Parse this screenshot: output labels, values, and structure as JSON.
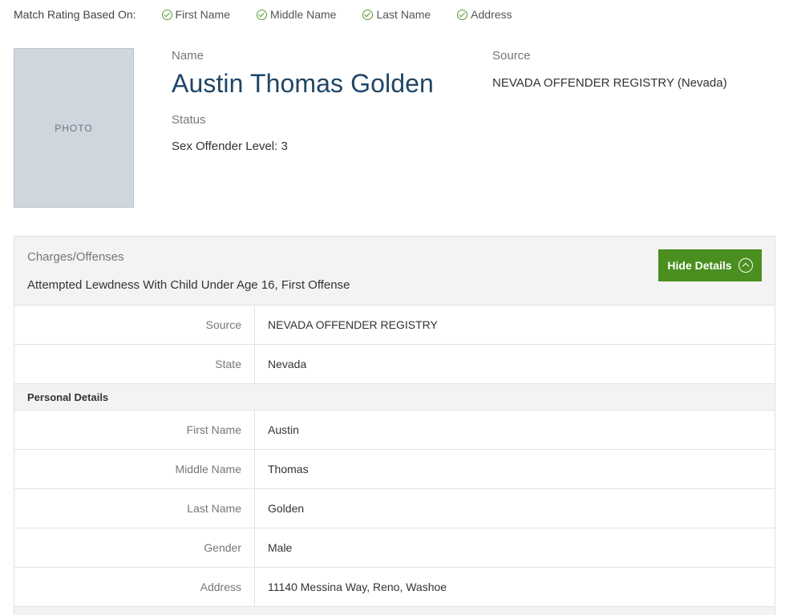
{
  "match": {
    "label": "Match Rating Based On:",
    "criteria": [
      "First Name",
      "Middle Name",
      "Last Name",
      "Address"
    ]
  },
  "photo": {
    "placeholder": "photo"
  },
  "record": {
    "name_label": "Name",
    "name": "Austin Thomas Golden",
    "status_label": "Status",
    "status": "Sex Offender Level: 3",
    "source_label": "Source",
    "source": "NEVADA OFFENDER REGISTRY (Nevada)"
  },
  "charges": {
    "title": "Charges/Offenses",
    "value": "Attempted Lewdness With Child Under Age 16, First Offense",
    "toggle_label": "Hide Details"
  },
  "detail_rows": [
    {
      "label": "Source",
      "value": "NEVADA OFFENDER REGISTRY"
    },
    {
      "label": "State",
      "value": "Nevada"
    }
  ],
  "personal": {
    "heading": "Personal Details",
    "rows": [
      {
        "label": "First Name",
        "value": "Austin"
      },
      {
        "label": "Middle Name",
        "value": "Thomas"
      },
      {
        "label": "Last Name",
        "value": "Golden"
      },
      {
        "label": "Gender",
        "value": "Male"
      },
      {
        "label": "Address",
        "value": "11140 Messina Way, Reno, Washoe"
      }
    ]
  },
  "colors": {
    "accent_green": "#4a8f1f",
    "name_blue": "#1f4666"
  }
}
